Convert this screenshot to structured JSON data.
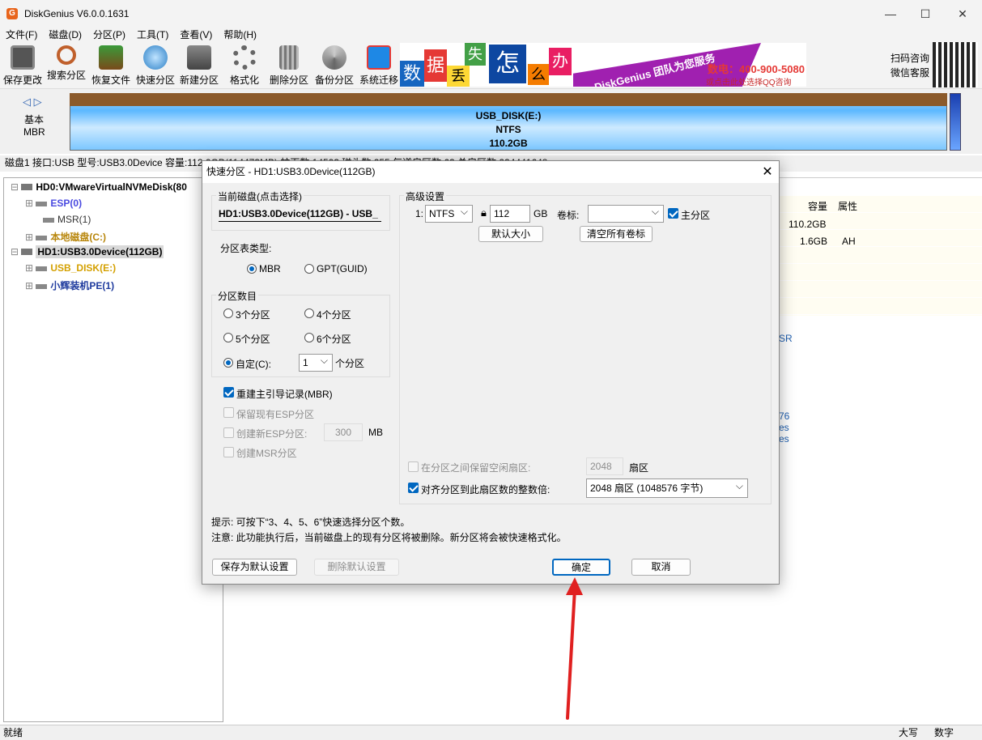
{
  "window": {
    "title": "DiskGenius V6.0.0.1631",
    "icon_letter": "G",
    "min": "—",
    "max": "☐",
    "close": "✕"
  },
  "menu": [
    "文件(F)",
    "磁盘(D)",
    "分区(P)",
    "工具(T)",
    "查看(V)",
    "帮助(H)"
  ],
  "toolbar": [
    {
      "label": "保存更改",
      "icon": "save-icon"
    },
    {
      "label": "搜索分区",
      "icon": "search-icon"
    },
    {
      "label": "恢复文件",
      "icon": "recover-icon"
    },
    {
      "label": "快速分区",
      "icon": "quick-partition-icon"
    },
    {
      "label": "新建分区",
      "icon": "new-partition-icon"
    },
    {
      "label": "格式化",
      "icon": "format-icon"
    },
    {
      "label": "删除分区",
      "icon": "delete-icon"
    },
    {
      "label": "备份分区",
      "icon": "backup-icon"
    },
    {
      "label": "系统迁移",
      "icon": "migrate-icon"
    }
  ],
  "banner": {
    "chars": [
      "数",
      "据",
      "丢",
      "失",
      "怎",
      "么",
      "办"
    ],
    "slogan": "DiskGenius 团队为您服务",
    "phone": "数电：400-900-5080",
    "qq": "或点击此处选择QQ咨询"
  },
  "contact": {
    "line1": "扫码咨询",
    "line2": "微信客服"
  },
  "disk_map": {
    "nav": "◁ ▷",
    "type1": "基本",
    "type2": "MBR",
    "name": "USB_DISK(E:)",
    "fs": "NTFS",
    "size": "110.2GB"
  },
  "disk_info": "磁盘1 接口:USB  型号:USB3.0Device  容量:112.0GB(114473MB)  柱面数:14593  磁头数:255  每道扇区数:63  总扇区数:234441648",
  "tree": [
    {
      "label": "HD0:VMwareVirtualNVMeDisk(80",
      "color": "#000",
      "bold": true
    },
    {
      "label": "ESP(0)",
      "color": "#4a4ae0",
      "bold": true
    },
    {
      "label": "MSR(1)",
      "color": "#333",
      "bold": false
    },
    {
      "label": "本地磁盘(C:)",
      "color": "#b8860b",
      "bold": true
    },
    {
      "label": "HD1:USB3.0Device(112GB)",
      "color": "#000",
      "bold": true
    },
    {
      "label": "USB_DISK(E:)",
      "color": "#d4a000",
      "bold": true
    },
    {
      "label": "小辉装机PE(1)",
      "color": "#1f3b9e",
      "bold": true
    }
  ],
  "right_table": {
    "headers": [
      "容量",
      "属性"
    ],
    "rows": [
      [
        "110.2GB",
        ""
      ],
      [
        "1.6GB",
        "AH"
      ]
    ]
  },
  "right_fragments": [
    "SR",
    "76",
    "es",
    "es"
  ],
  "status": {
    "left": "就绪",
    "caps": "大写",
    "num": "数字"
  },
  "dialog": {
    "title": "快速分区 - HD1:USB3.0Device(112GB)",
    "current_disk_label": "当前磁盘(点击选择)",
    "current_disk_value": "HD1:USB3.0Device(112GB) - USB_",
    "ptable_label": "分区表类型:",
    "mbr": "MBR",
    "gpt": "GPT(GUID)",
    "count_label": "分区数目",
    "opt3": "3个分区",
    "opt4": "4个分区",
    "opt5": "5个分区",
    "opt6": "6个分区",
    "custom": "自定(C):",
    "custom_value": "1",
    "custom_unit": "个分区",
    "rebuild_mbr": "重建主引导记录(MBR)",
    "keep_esp": "保留现有ESP分区",
    "create_esp": "创建新ESP分区:",
    "esp_size": "300",
    "esp_unit": "MB",
    "create_msr": "创建MSR分区",
    "adv_label": "高级设置",
    "row_index": "1:",
    "fs": "NTFS",
    "size": "112",
    "size_unit": "GB",
    "vol_label": "卷标:",
    "vol_value": "",
    "primary": "主分区",
    "default_size": "默认大小",
    "clear_labels": "清空所有卷标",
    "reserve_label": "在分区之间保留空闲扇区:",
    "reserve_value": "2048",
    "reserve_unit": "扇区",
    "align_label": "对齐分区到此扇区数的整数倍:",
    "align_value": "2048 扇区 (1048576 字节)",
    "hint1": "提示: 可按下“3、4、5、6”快速选择分区个数。",
    "hint2": "注意: 此功能执行后，当前磁盘上的现有分区将被删除。新分区将会被快速格式化。",
    "save_default": "保存为默认设置",
    "delete_default": "删除默认设置",
    "ok": "确定",
    "cancel": "取消"
  }
}
